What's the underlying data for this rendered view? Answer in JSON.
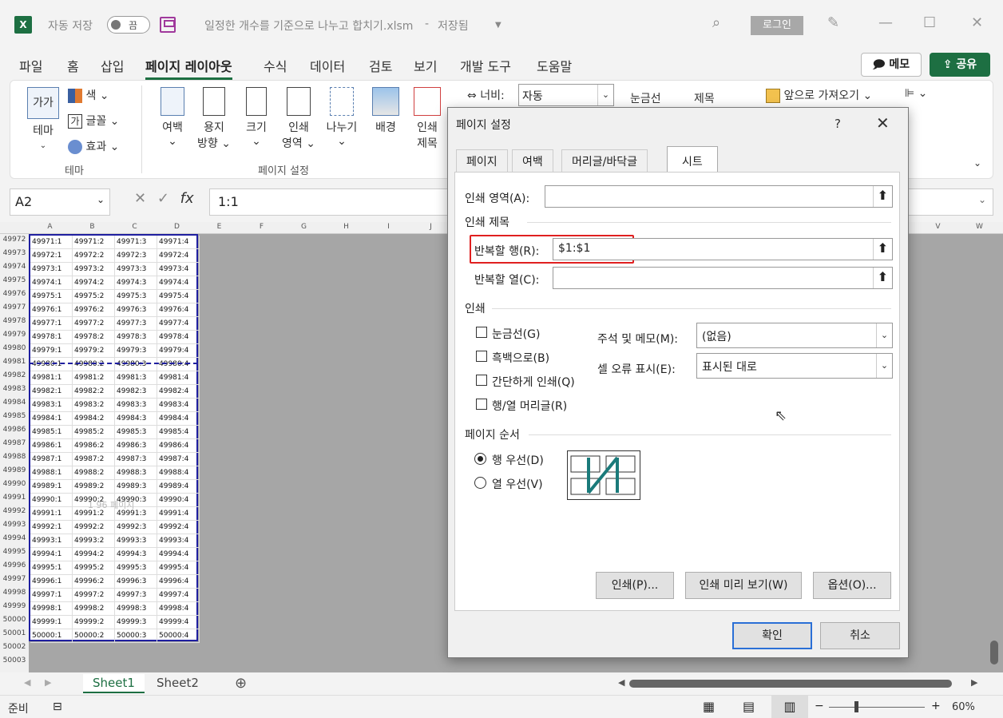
{
  "titlebar": {
    "autosave_label": "자동 저장",
    "toggle_state": "끔",
    "filename": "일정한 개수를 기준으로 나누고 합치기.xlsm",
    "save_status": "저장됨",
    "login": "로그인"
  },
  "tabs": {
    "items": [
      "파일",
      "홈",
      "삽입",
      "페이지 레이아웃",
      "수식",
      "데이터",
      "검토",
      "보기",
      "개발 도구",
      "도움말"
    ],
    "memo": "메모",
    "share": "공유"
  },
  "ribbon": {
    "theme_group": {
      "themes": "테마",
      "colors": "색",
      "fonts": "글꼴",
      "effects": "효과",
      "label": "테마",
      "theme_icon_text": "가가"
    },
    "page_setup": {
      "margins": "여백",
      "orientation1": "용지",
      "orientation2": "방향",
      "size": "크기",
      "print_area1": "인쇄",
      "print_area2": "영역",
      "breaks": "나누기",
      "background": "배경",
      "print_titles1": "인쇄",
      "print_titles2": "제목",
      "label": "페이지 설정"
    },
    "scale": {
      "width_label": "너비:",
      "width_value": "자동"
    },
    "sheet_options": {
      "gridlines": "눈금선",
      "headings": "제목"
    },
    "arrange": {
      "bring_forward": "앞으로 가져오기"
    }
  },
  "formulabar": {
    "namebox": "A2",
    "formula": "1:1",
    "fx": "fx"
  },
  "sheet": {
    "columns": [
      "A",
      "B",
      "C",
      "D",
      "E",
      "F",
      "G",
      "H",
      "I",
      "J",
      "V",
      "W"
    ],
    "first_row": 49972,
    "last_data_row": 50001,
    "extra_rows": [
      "50002",
      "50003"
    ],
    "watermark": "1 96 페이지"
  },
  "sheettabs": {
    "tabs": [
      "Sheet1",
      "Sheet2"
    ]
  },
  "statusbar": {
    "ready": "준비",
    "zoom": "60%"
  },
  "dialog": {
    "title": "페이지 설정",
    "help": "?",
    "tabs": [
      "페이지",
      "여백",
      "머리글/바닥글",
      "시트"
    ],
    "print_area_label": "인쇄 영역(A):",
    "print_area_value": "",
    "print_titles_section": "인쇄 제목",
    "rows_repeat_label": "반복할 행(R):",
    "rows_repeat_value": "$1:$1",
    "cols_repeat_label": "반복할 열(C):",
    "cols_repeat_value": "",
    "print_section": "인쇄",
    "checkboxes": [
      "눈금선(G)",
      "흑백으로(B)",
      "간단하게 인쇄(Q)",
      "행/열 머리글(R)"
    ],
    "comments_label": "주석 및 메모(M):",
    "comments_value": "(없음)",
    "errors_label": "셀 오류 표시(E):",
    "errors_value": "표시된 대로",
    "page_order_section": "페이지 순서",
    "radio_down": "행 우선(D)",
    "radio_over": "열 우선(V)",
    "btn_print": "인쇄(P)...",
    "btn_preview": "인쇄 미리 보기(W)",
    "btn_options": "옵션(O)...",
    "btn_ok": "확인",
    "btn_cancel": "취소"
  }
}
